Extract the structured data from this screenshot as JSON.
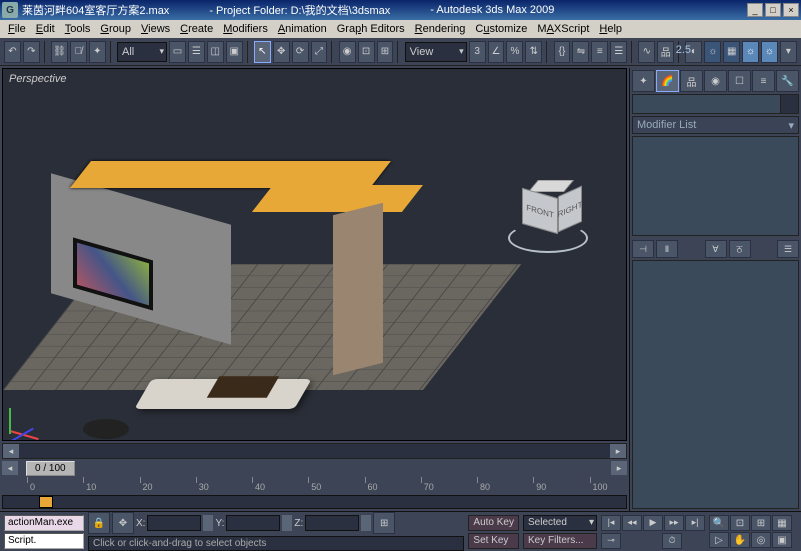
{
  "titlebar": {
    "filename": "莱茵河畔604室客厅方案2.max",
    "project_label": "- Project Folder: D:\\我的文档\\3dsmax",
    "app": "- Autodesk 3ds Max 2009",
    "icon_letter": "G"
  },
  "menu": {
    "file": "File",
    "edit": "Edit",
    "tools": "Tools",
    "group": "Group",
    "views": "Views",
    "create": "Create",
    "modifiers": "Modifiers",
    "animation": "Animation",
    "graph": "Graph Editors",
    "rendering": "Rendering",
    "customize": "Customize",
    "maxscript": "MAXScript",
    "help": "Help"
  },
  "toolbar": {
    "filter": "All",
    "view_label": "View",
    "gi_label": "2.5"
  },
  "viewport": {
    "label": "Perspective",
    "viewcube": {
      "front": "FRONT",
      "right": "RIGHT"
    }
  },
  "cmdpanel": {
    "modifier_list": "Modifier List"
  },
  "timeline": {
    "knob": "0 / 100",
    "ticks": [
      "0",
      "10",
      "20",
      "30",
      "40",
      "50",
      "60",
      "70",
      "80",
      "90",
      "100"
    ]
  },
  "status": {
    "script_name": "actionMan.exe",
    "script_label": "Script.",
    "prompt": "Click or click-and-drag to select objects",
    "x": "X:",
    "y": "Y:",
    "z": "Z:",
    "autokey": "Auto Key",
    "setkey": "Set Key",
    "keyfilters": "Key Filters...",
    "selected": "Selected"
  }
}
